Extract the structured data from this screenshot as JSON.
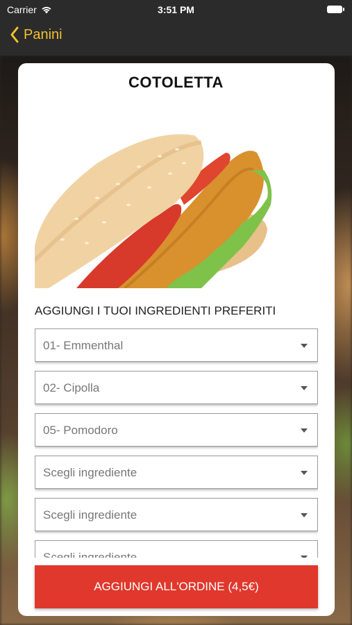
{
  "status": {
    "carrier": "Carrier",
    "time": "3:51 PM"
  },
  "nav": {
    "back_label": "Panini"
  },
  "product": {
    "title": "COTOLETTA"
  },
  "section": {
    "subtitle": "AGGIUNGI I TUOI INGREDIENTI PREFERITI"
  },
  "ingredients": [
    "01- Emmenthal",
    "02- Cipolla",
    "05- Pomodoro",
    "Scegli ingrediente",
    "Scegli ingrediente",
    "Scegli ingrediente"
  ],
  "order": {
    "button_label": "AGGIUNGI ALL'ORDINE (4,5€)"
  },
  "colors": {
    "accent": "#f2c230",
    "button": "#e0382c",
    "bar": "#2b2b2b"
  }
}
